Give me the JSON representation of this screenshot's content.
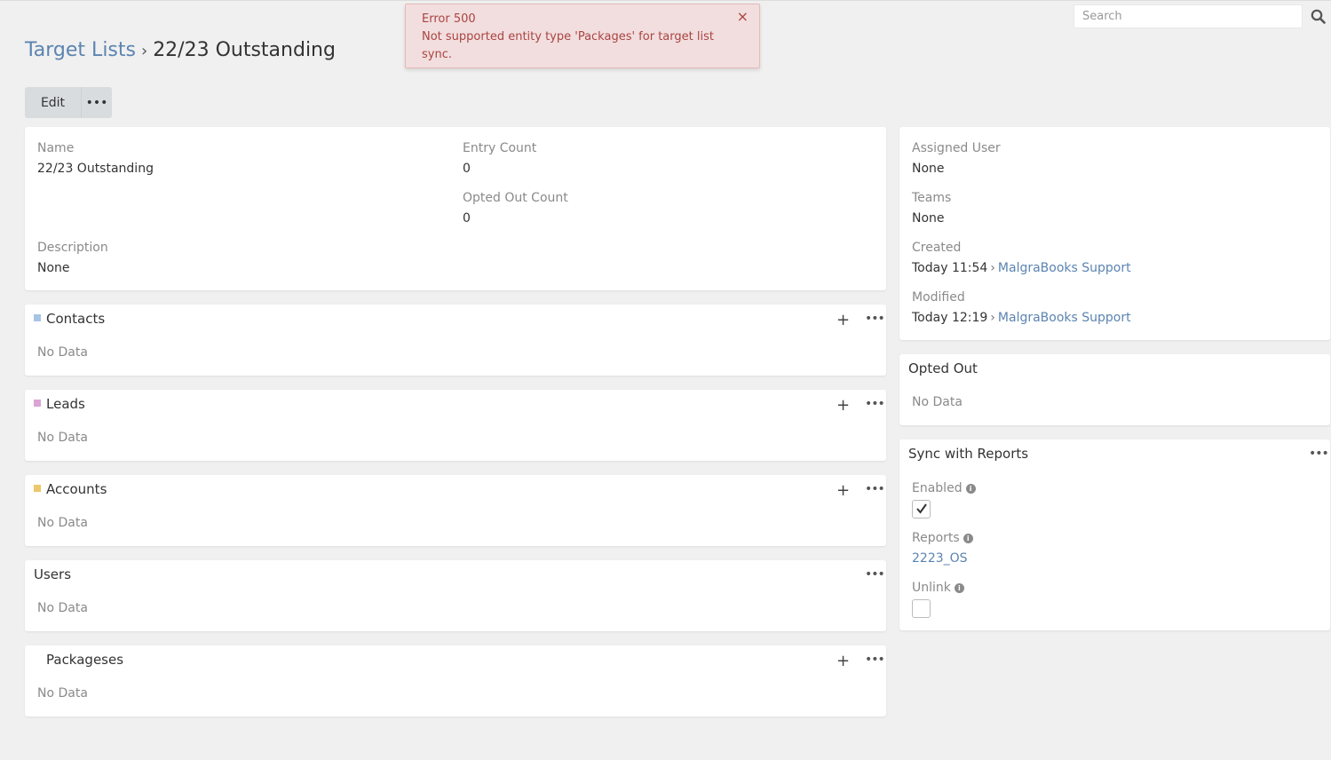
{
  "search": {
    "placeholder": "Search"
  },
  "toast": {
    "title": "Error 500",
    "message": "Not supported entity type 'Packages' for target list sync.",
    "close": "×"
  },
  "breadcrumb": {
    "parent": "Target Lists",
    "separator": "›",
    "current": "22/23 Outstanding"
  },
  "actions": {
    "edit": "Edit",
    "more": "•••"
  },
  "overview": {
    "name_label": "Name",
    "name_value": "22/23 Outstanding",
    "entry_count_label": "Entry Count",
    "entry_count_value": "0",
    "opted_out_count_label": "Opted Out Count",
    "opted_out_count_value": "0",
    "description_label": "Description",
    "description_value": "None"
  },
  "panels": {
    "contacts": {
      "title": "Contacts",
      "empty": "No Data",
      "color": "#a7c4e6",
      "plus": "+",
      "more": "•••"
    },
    "leads": {
      "title": "Leads",
      "empty": "No Data",
      "color": "#dba4d4",
      "plus": "+",
      "more": "•••"
    },
    "accounts": {
      "title": "Accounts",
      "empty": "No Data",
      "color": "#ecc86a",
      "plus": "+",
      "more": "•••"
    },
    "users": {
      "title": "Users",
      "empty": "No Data",
      "more": "•••"
    },
    "packageses": {
      "title": "Packageses",
      "empty": "No Data",
      "plus": "+",
      "more": "•••"
    }
  },
  "side": {
    "assigned_user_label": "Assigned User",
    "assigned_user_value": "None",
    "teams_label": "Teams",
    "teams_value": "None",
    "created_label": "Created",
    "created_time": "Today 11:54",
    "created_by": "MalgraBooks Support",
    "modified_label": "Modified",
    "modified_time": "Today 12:19",
    "modified_by": "MalgraBooks Support",
    "arrow": "›"
  },
  "opted_out": {
    "title": "Opted Out",
    "empty": "No Data"
  },
  "sync": {
    "title": "Sync with Reports",
    "more": "•••",
    "enabled_label": "Enabled",
    "enabled_checked": true,
    "reports_label": "Reports",
    "reports_value": "2223_OS",
    "unlink_label": "Unlink",
    "unlink_checked": false,
    "info": "i"
  }
}
